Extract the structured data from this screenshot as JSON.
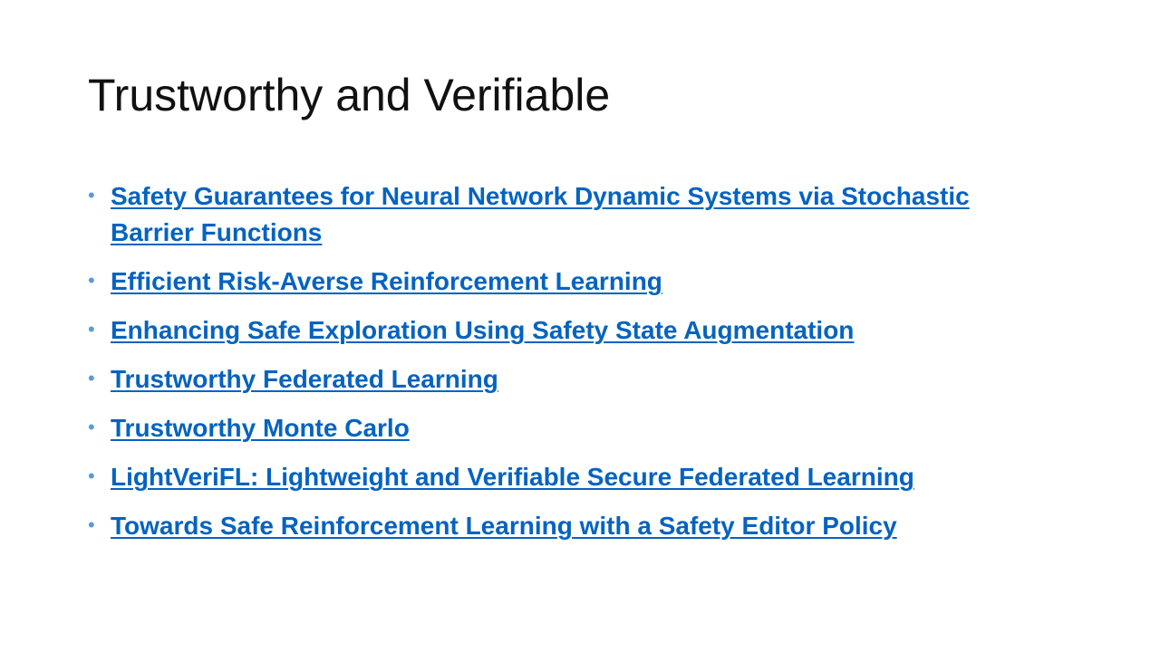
{
  "slide": {
    "title": "Trustworthy and Verifiable",
    "bullet_glyph": "•",
    "items": [
      {
        "label": "Safety Guarantees for Neural Network Dynamic Systems via Stochastic Barrier Functions"
      },
      {
        "label": "Efficient Risk-Averse Reinforcement Learning"
      },
      {
        "label": "Enhancing Safe Exploration Using Safety State Augmentation"
      },
      {
        "label": "Trustworthy Federated Learning "
      },
      {
        "label": "Trustworthy Monte Carlo"
      },
      {
        "label": "LightVeriFL: Lightweight and Verifiable Secure Federated Learning"
      },
      {
        "label": "Towards Safe Reinforcement Learning with a Safety Editor Policy"
      }
    ],
    "colors": {
      "link": "#0563c1",
      "bullet": "#5b9bd5",
      "title": "#111111"
    }
  }
}
